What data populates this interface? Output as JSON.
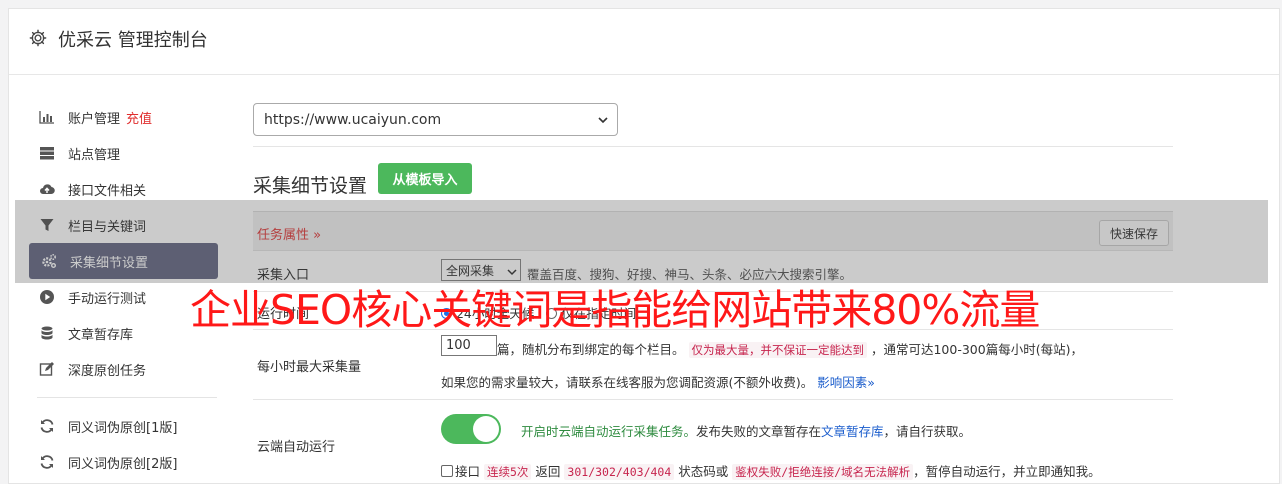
{
  "header": {
    "title": "优采云 管理控制台",
    "icon": "gear-icon"
  },
  "sidebar": {
    "items": [
      {
        "label": "账户管理",
        "extra": "充值",
        "icon": "bar-chart-icon"
      },
      {
        "label": "站点管理",
        "icon": "server-icon"
      },
      {
        "label": "接口文件相关",
        "icon": "cloud-upload-icon"
      },
      {
        "label": "栏目与关键词",
        "icon": "filter-icon"
      },
      {
        "label": "采集细节设置",
        "icon": "cogs-icon",
        "active": true
      },
      {
        "label": "手动运行测试",
        "icon": "play-circle-icon"
      },
      {
        "label": "文章暂存库",
        "icon": "database-icon"
      },
      {
        "label": "深度原创任务",
        "icon": "edit-icon"
      },
      {
        "label": "同义词伪原创[1版]",
        "icon": "refresh-icon"
      },
      {
        "label": "同义词伪原创[2版]",
        "icon": "refresh-icon"
      }
    ]
  },
  "main": {
    "site_select": "https://www.ucaiyun.com",
    "section_title": "采集细节设置",
    "import_button": "从模板导入",
    "task_attr_label": "任务属性 »",
    "quick_save": "快速保存",
    "rows": {
      "entry": {
        "label": "采集入口",
        "select": "全网采集",
        "desc": "覆盖百度、搜狗、好搜、神马、头条、必应六大搜索引擎。"
      },
      "runtime": {
        "label": "运行时间",
        "option1": "24小时全天候",
        "option2": "仅在指定时间"
      },
      "max_per_hour": {
        "label": "每小时最大采集量",
        "value": "100",
        "text1": "篇，随机分布到绑定的每个栏目。",
        "code1": "仅为最大量，并不保证一定能达到",
        "text2": "，通常可达100-300篇每小时(每站)，",
        "text3": "如果您的需求量较大，请联系在线客服为您调配资源(不额外收费)。",
        "link": "影响因素»"
      },
      "cloud": {
        "label": "云端自动运行",
        "toggle_text": "开启时云端自动运行采集任务。",
        "text1": "发布失败的文章暂存在",
        "link": "文章暂存库",
        "text2": "，请自行获取。",
        "cb_label": "接口",
        "code1": "连续5次",
        "text3": "返回",
        "code2": "301/302/403/404",
        "text4": "状态码或",
        "code3": "鉴权失败/拒绝连接/域名无法解析",
        "text5": "，暂停自动运行，并立即通知我。"
      }
    }
  },
  "overlay": {
    "caption": "企业SEO核心关键词是指能给网站带来80%流量"
  },
  "colors": {
    "accent_green": "#4cb85c",
    "active_nav": "#676a86",
    "alert_red": "#ff1818"
  }
}
